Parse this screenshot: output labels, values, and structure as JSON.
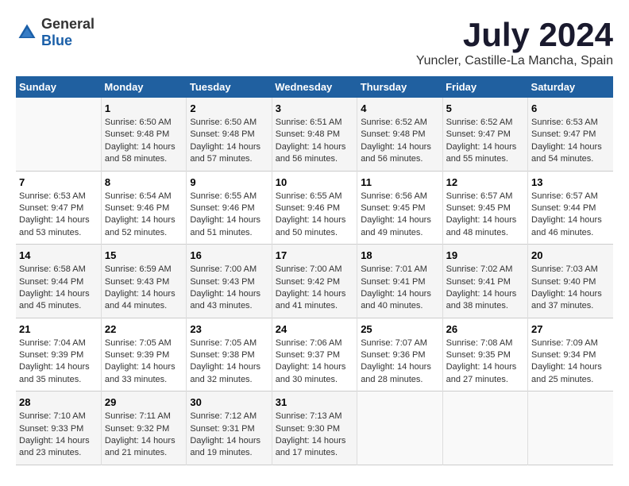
{
  "logo": {
    "text_general": "General",
    "text_blue": "Blue"
  },
  "title": "July 2024",
  "subtitle": "Yuncler, Castille-La Mancha, Spain",
  "days_of_week": [
    "Sunday",
    "Monday",
    "Tuesday",
    "Wednesday",
    "Thursday",
    "Friday",
    "Saturday"
  ],
  "weeks": [
    [
      {
        "day": "",
        "sunrise": "",
        "sunset": "",
        "daylight": ""
      },
      {
        "day": "1",
        "sunrise": "Sunrise: 6:50 AM",
        "sunset": "Sunset: 9:48 PM",
        "daylight": "Daylight: 14 hours and 58 minutes."
      },
      {
        "day": "2",
        "sunrise": "Sunrise: 6:50 AM",
        "sunset": "Sunset: 9:48 PM",
        "daylight": "Daylight: 14 hours and 57 minutes."
      },
      {
        "day": "3",
        "sunrise": "Sunrise: 6:51 AM",
        "sunset": "Sunset: 9:48 PM",
        "daylight": "Daylight: 14 hours and 56 minutes."
      },
      {
        "day": "4",
        "sunrise": "Sunrise: 6:52 AM",
        "sunset": "Sunset: 9:48 PM",
        "daylight": "Daylight: 14 hours and 56 minutes."
      },
      {
        "day": "5",
        "sunrise": "Sunrise: 6:52 AM",
        "sunset": "Sunset: 9:47 PM",
        "daylight": "Daylight: 14 hours and 55 minutes."
      },
      {
        "day": "6",
        "sunrise": "Sunrise: 6:53 AM",
        "sunset": "Sunset: 9:47 PM",
        "daylight": "Daylight: 14 hours and 54 minutes."
      }
    ],
    [
      {
        "day": "7",
        "sunrise": "Sunrise: 6:53 AM",
        "sunset": "Sunset: 9:47 PM",
        "daylight": "Daylight: 14 hours and 53 minutes."
      },
      {
        "day": "8",
        "sunrise": "Sunrise: 6:54 AM",
        "sunset": "Sunset: 9:46 PM",
        "daylight": "Daylight: 14 hours and 52 minutes."
      },
      {
        "day": "9",
        "sunrise": "Sunrise: 6:55 AM",
        "sunset": "Sunset: 9:46 PM",
        "daylight": "Daylight: 14 hours and 51 minutes."
      },
      {
        "day": "10",
        "sunrise": "Sunrise: 6:55 AM",
        "sunset": "Sunset: 9:46 PM",
        "daylight": "Daylight: 14 hours and 50 minutes."
      },
      {
        "day": "11",
        "sunrise": "Sunrise: 6:56 AM",
        "sunset": "Sunset: 9:45 PM",
        "daylight": "Daylight: 14 hours and 49 minutes."
      },
      {
        "day": "12",
        "sunrise": "Sunrise: 6:57 AM",
        "sunset": "Sunset: 9:45 PM",
        "daylight": "Daylight: 14 hours and 48 minutes."
      },
      {
        "day": "13",
        "sunrise": "Sunrise: 6:57 AM",
        "sunset": "Sunset: 9:44 PM",
        "daylight": "Daylight: 14 hours and 46 minutes."
      }
    ],
    [
      {
        "day": "14",
        "sunrise": "Sunrise: 6:58 AM",
        "sunset": "Sunset: 9:44 PM",
        "daylight": "Daylight: 14 hours and 45 minutes."
      },
      {
        "day": "15",
        "sunrise": "Sunrise: 6:59 AM",
        "sunset": "Sunset: 9:43 PM",
        "daylight": "Daylight: 14 hours and 44 minutes."
      },
      {
        "day": "16",
        "sunrise": "Sunrise: 7:00 AM",
        "sunset": "Sunset: 9:43 PM",
        "daylight": "Daylight: 14 hours and 43 minutes."
      },
      {
        "day": "17",
        "sunrise": "Sunrise: 7:00 AM",
        "sunset": "Sunset: 9:42 PM",
        "daylight": "Daylight: 14 hours and 41 minutes."
      },
      {
        "day": "18",
        "sunrise": "Sunrise: 7:01 AM",
        "sunset": "Sunset: 9:41 PM",
        "daylight": "Daylight: 14 hours and 40 minutes."
      },
      {
        "day": "19",
        "sunrise": "Sunrise: 7:02 AM",
        "sunset": "Sunset: 9:41 PM",
        "daylight": "Daylight: 14 hours and 38 minutes."
      },
      {
        "day": "20",
        "sunrise": "Sunrise: 7:03 AM",
        "sunset": "Sunset: 9:40 PM",
        "daylight": "Daylight: 14 hours and 37 minutes."
      }
    ],
    [
      {
        "day": "21",
        "sunrise": "Sunrise: 7:04 AM",
        "sunset": "Sunset: 9:39 PM",
        "daylight": "Daylight: 14 hours and 35 minutes."
      },
      {
        "day": "22",
        "sunrise": "Sunrise: 7:05 AM",
        "sunset": "Sunset: 9:39 PM",
        "daylight": "Daylight: 14 hours and 33 minutes."
      },
      {
        "day": "23",
        "sunrise": "Sunrise: 7:05 AM",
        "sunset": "Sunset: 9:38 PM",
        "daylight": "Daylight: 14 hours and 32 minutes."
      },
      {
        "day": "24",
        "sunrise": "Sunrise: 7:06 AM",
        "sunset": "Sunset: 9:37 PM",
        "daylight": "Daylight: 14 hours and 30 minutes."
      },
      {
        "day": "25",
        "sunrise": "Sunrise: 7:07 AM",
        "sunset": "Sunset: 9:36 PM",
        "daylight": "Daylight: 14 hours and 28 minutes."
      },
      {
        "day": "26",
        "sunrise": "Sunrise: 7:08 AM",
        "sunset": "Sunset: 9:35 PM",
        "daylight": "Daylight: 14 hours and 27 minutes."
      },
      {
        "day": "27",
        "sunrise": "Sunrise: 7:09 AM",
        "sunset": "Sunset: 9:34 PM",
        "daylight": "Daylight: 14 hours and 25 minutes."
      }
    ],
    [
      {
        "day": "28",
        "sunrise": "Sunrise: 7:10 AM",
        "sunset": "Sunset: 9:33 PM",
        "daylight": "Daylight: 14 hours and 23 minutes."
      },
      {
        "day": "29",
        "sunrise": "Sunrise: 7:11 AM",
        "sunset": "Sunset: 9:32 PM",
        "daylight": "Daylight: 14 hours and 21 minutes."
      },
      {
        "day": "30",
        "sunrise": "Sunrise: 7:12 AM",
        "sunset": "Sunset: 9:31 PM",
        "daylight": "Daylight: 14 hours and 19 minutes."
      },
      {
        "day": "31",
        "sunrise": "Sunrise: 7:13 AM",
        "sunset": "Sunset: 9:30 PM",
        "daylight": "Daylight: 14 hours and 17 minutes."
      },
      {
        "day": "",
        "sunrise": "",
        "sunset": "",
        "daylight": ""
      },
      {
        "day": "",
        "sunrise": "",
        "sunset": "",
        "daylight": ""
      },
      {
        "day": "",
        "sunrise": "",
        "sunset": "",
        "daylight": ""
      }
    ]
  ]
}
